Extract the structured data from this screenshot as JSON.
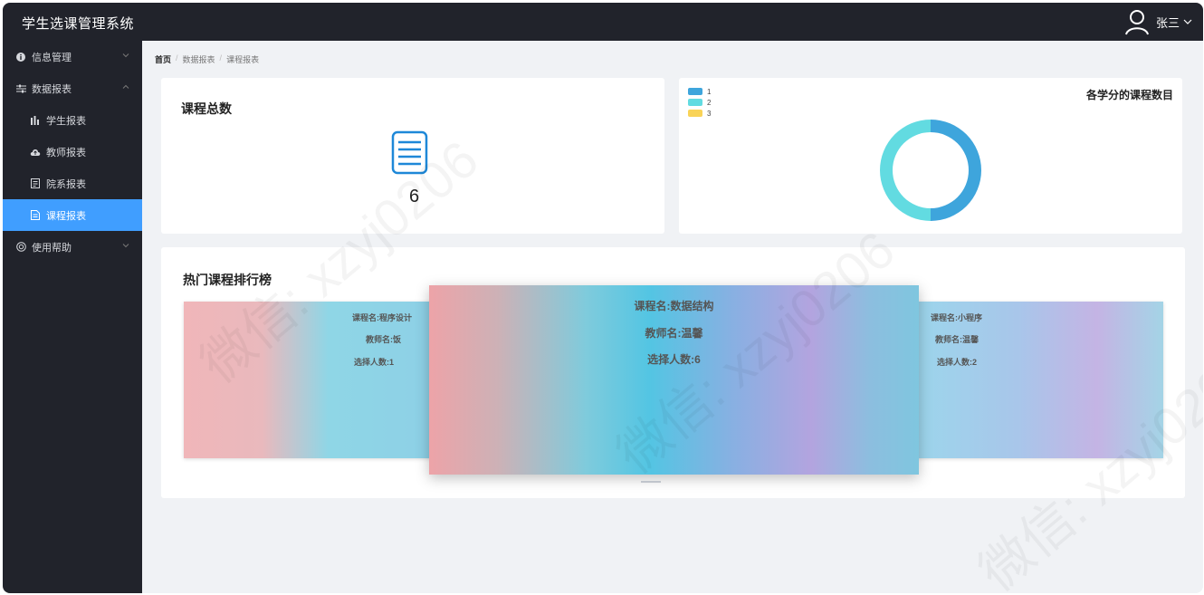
{
  "app_title": "学生选课管理系统",
  "user": {
    "name": "张三"
  },
  "sidebar": {
    "items": [
      {
        "label": "信息管理"
      },
      {
        "label": "数据报表"
      },
      {
        "label": "学生报表"
      },
      {
        "label": "教师报表"
      },
      {
        "label": "院系报表"
      },
      {
        "label": "课程报表"
      },
      {
        "label": "使用帮助"
      }
    ],
    "active": "课程报表"
  },
  "breadcrumb": [
    "首页",
    "数据报表",
    "课程报表"
  ],
  "total_card": {
    "title": "课程总数",
    "value": "6"
  },
  "credit_chart": {
    "title": "各学分的课程数目"
  },
  "chart_data": {
    "type": "pie",
    "title": "各学分的课程数目",
    "legend": [
      "1",
      "2",
      "3"
    ],
    "legend_position": "top-left",
    "values": [
      3,
      3,
      0
    ],
    "colors": [
      "#3ea5dc",
      "#62dbe1",
      "#f9d357"
    ]
  },
  "hot_courses": {
    "title": "热门课程排行榜",
    "slides": [
      {
        "course": "课程名:程序设计",
        "teacher": "教师名:饭",
        "count": "选择人数:1"
      },
      {
        "course": "课程名:数据结构",
        "teacher": "教师名:温馨",
        "count": "选择人数:6"
      },
      {
        "course": "课程名:小程序",
        "teacher": "教师名:温馨",
        "count": "选择人数:2"
      }
    ]
  },
  "watermark": "微信: xzyj0206",
  "colors": {
    "header_bg": "#21232b",
    "sidebar_bg": "#21232b",
    "active": "#409eff",
    "content_bg": "#f0f2f5"
  }
}
